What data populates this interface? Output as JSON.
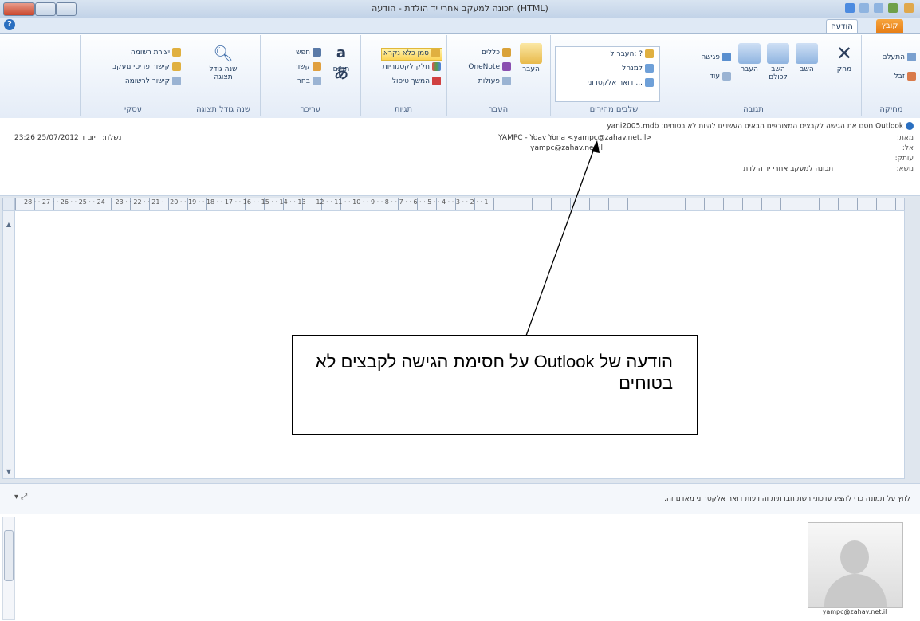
{
  "window": {
    "title": "תכונה למעקב אחרי יד הולדת - הודעה (HTML)"
  },
  "tabs": {
    "file": "קובץ",
    "message": "הודעה"
  },
  "ribbon": {
    "groups": {
      "delete": {
        "label": "מחיקה",
        "ignore": "התעלם",
        "junk": "זבל",
        "delete": "מחק"
      },
      "respond": {
        "label": "תגובה",
        "reply": "השב",
        "reply_all": "השב לכולם",
        "forward": "העבר",
        "meeting": "פגישה",
        "more": "עוד"
      },
      "quick_steps": {
        "label": "שלבים מהירים",
        "items": [
          "העבר ל: ?",
          "למנהל",
          "דואר אלקטרוני ..."
        ]
      },
      "move": {
        "label": "העבר",
        "move": "העבר",
        "rules": "כללים",
        "onenote": "OneNote",
        "actions": "פעולות"
      },
      "tags": {
        "label": "תגיות",
        "mark_unread": "סמן כלא נקרא",
        "categorize": "חלק לקטגוריות",
        "follow_up": "המשך טיפול"
      },
      "editing": {
        "label": "עריכה",
        "translate": "תרגם",
        "find": "חפש",
        "related": "קשור",
        "select": "בחר"
      },
      "zoom": {
        "label": "שנה גודל תצוגה",
        "zoom": "שנה גודל תצוגה"
      },
      "onenote_group": {
        "label": "עסקי",
        "create_list": "יצירת רשומה",
        "link_view": "קישור פריטי מעקב",
        "link_list": "קישור לרשומה"
      }
    }
  },
  "header": {
    "info_bar": "Outlook חסם את הגישה לקבצים המצורפים הבאים העשויים להיות לא בטוחים: yani2005.mdb",
    "from_label": "מאת:",
    "from_value": "YAMPC - Yoav Yona <yampc@zahav.net.il>",
    "to_label": "אל:",
    "to_value": "yampc@zahav.net.il",
    "cc_label": "עותק:",
    "subject_label": "נושא:",
    "subject_value": "תכונה למעקב אחרי יד הולדת",
    "sent_label": "נשלח:",
    "sent_value": "יום ד 25/07/2012 23:26"
  },
  "ruler": {
    "ticks": "28 · · 27 · · 26 · · 25 · · 24 · · 23 · · 22 · · 21 · · 20 · · 19 · · 18 · · 17 · · 16 · · 15 · · 14 · · 13 · · 12 · · 11 · · 10 · · 9 · · 8 · · 7 · · 6 · · 5 · · 4 · · 3 · · 2 · · 1"
  },
  "callout": {
    "text": "הודעה של Outlook על חסימת הגישה לקבצים לא בטוחים"
  },
  "people_pane": {
    "hint": "לחץ על תמונה כדי להציג עדכוני רשת חברתית והודעות דואר אלקטרוני מאדם זה.",
    "contact_email": "yampc@zahav.net.il"
  },
  "colors": {
    "accent": "#2a6fc0",
    "file_tab": "#e67c14",
    "highlight": "#fcd457"
  }
}
